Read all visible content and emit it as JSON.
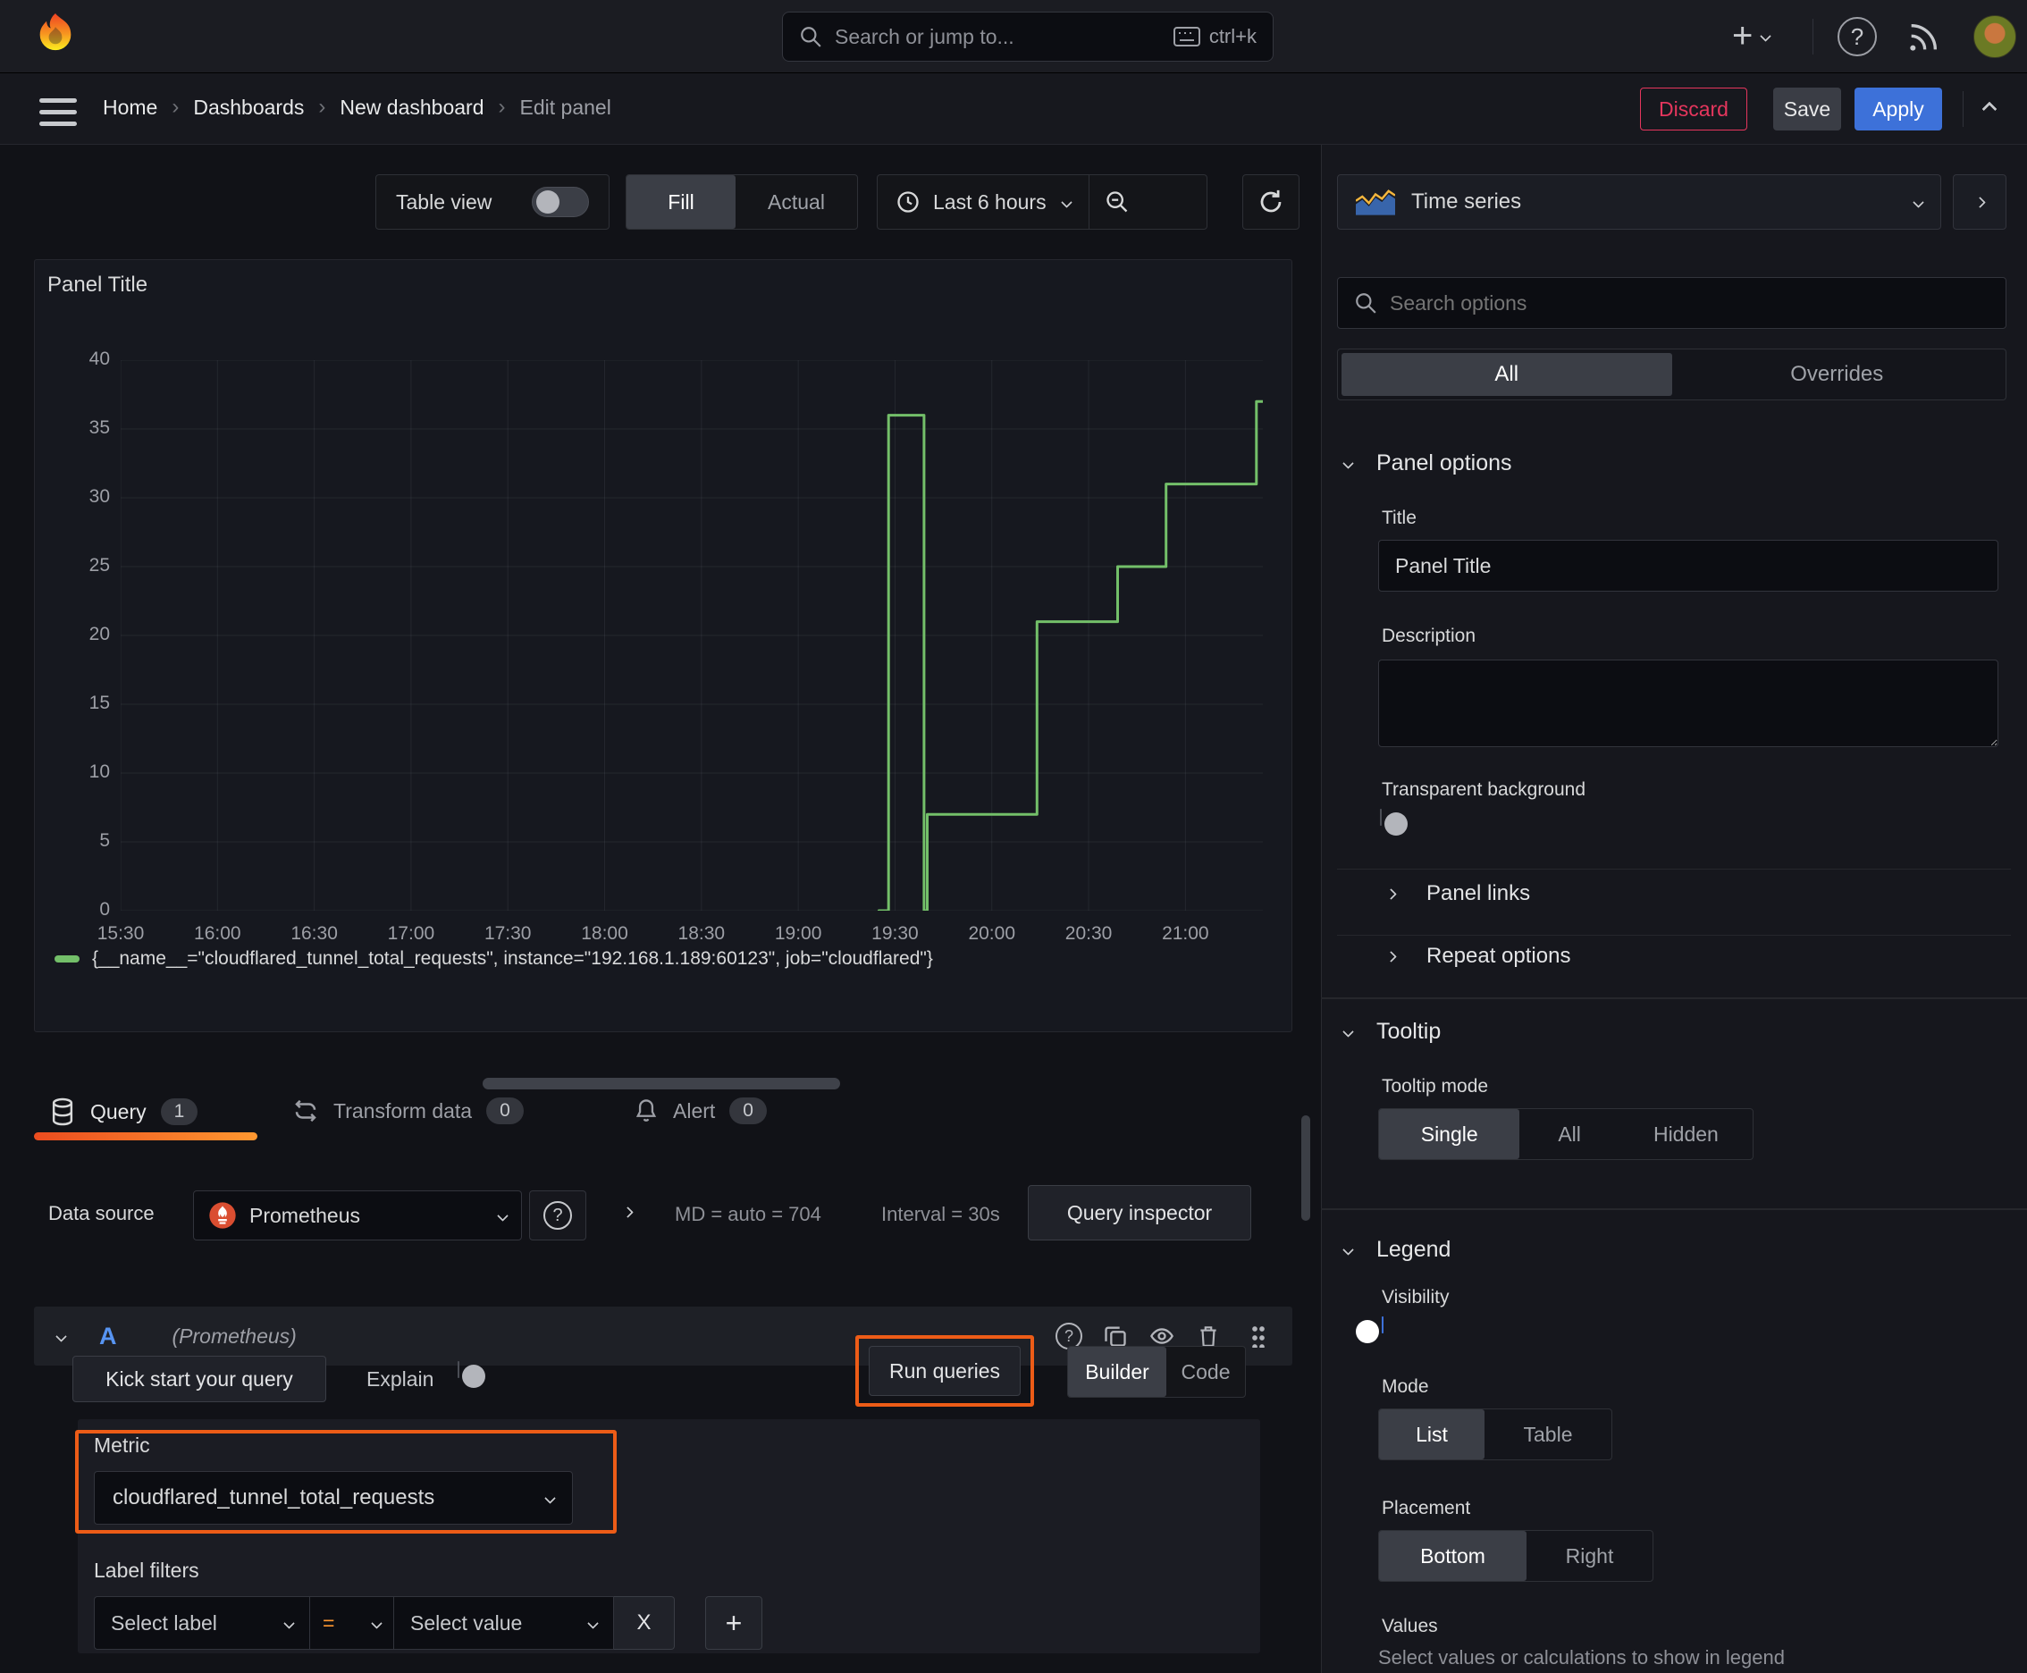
{
  "topbar": {
    "search_placeholder": "Search or jump to...",
    "search_shortcut": "ctrl+k"
  },
  "breadcrumb": {
    "items": [
      "Home",
      "Dashboards",
      "New dashboard"
    ],
    "current": "Edit panel",
    "separator": "›"
  },
  "actions": {
    "discard": "Discard",
    "save": "Save",
    "apply": "Apply"
  },
  "toolbar": {
    "table_view": "Table view",
    "fill": "Fill",
    "actual": "Actual",
    "time_range": "Last 6 hours"
  },
  "panel": {
    "title": "Panel Title"
  },
  "chart_data": {
    "type": "line",
    "style": "step-after",
    "title": "Panel Title",
    "xlabel": "",
    "ylabel": "",
    "ylim": [
      0,
      40
    ],
    "yticks": [
      0,
      5,
      10,
      15,
      20,
      25,
      30,
      35,
      40
    ],
    "xticks": [
      "15:30",
      "16:00",
      "16:30",
      "17:00",
      "17:30",
      "18:00",
      "18:30",
      "19:00",
      "19:30",
      "20:00",
      "20:30",
      "21:00"
    ],
    "x_max": "21:24",
    "grid": true,
    "legend_position": "bottom",
    "color": "#73bf69",
    "series": [
      {
        "name": "{__name__=\"cloudflared_tunnel_total_requests\", instance=\"192.168.1.189:60123\", job=\"cloudflared\"}",
        "points": [
          [
            "19:25",
            0
          ],
          [
            "19:28",
            0
          ],
          [
            "19:28",
            36
          ],
          [
            "19:39",
            36
          ],
          [
            "19:39",
            0
          ],
          [
            "19:40",
            0
          ],
          [
            "19:40",
            7
          ],
          [
            "20:14",
            7
          ],
          [
            "20:14",
            21
          ],
          [
            "20:39",
            21
          ],
          [
            "20:39",
            25
          ],
          [
            "20:54",
            25
          ],
          [
            "20:54",
            31
          ],
          [
            "21:22",
            31
          ],
          [
            "21:22",
            37
          ],
          [
            "21:24",
            37
          ]
        ]
      }
    ]
  },
  "tabs": {
    "query": "Query",
    "query_count": "1",
    "transform": "Transform data",
    "transform_count": "0",
    "alert": "Alert",
    "alert_count": "0"
  },
  "query": {
    "data_source_label": "Data source",
    "data_source": "Prometheus",
    "md": "MD = auto = 704",
    "interval": "Interval = 30s",
    "inspector": "Query inspector",
    "ref_id": "A",
    "ref_ds": "(Prometheus)",
    "kick_start": "Kick start your query",
    "explain": "Explain",
    "run": "Run queries",
    "builder": "Builder",
    "code": "Code",
    "metric_label": "Metric",
    "metric_value": "cloudflared_tunnel_total_requests",
    "label_filters": "Label filters",
    "select_label": "Select label",
    "operator": "=",
    "select_value": "Select value",
    "remove": "X",
    "add": "+"
  },
  "options": {
    "viz": "Time series",
    "search_placeholder": "Search options",
    "tab_all": "All",
    "tab_overrides": "Overrides",
    "panel_options": {
      "title": "Panel options",
      "title_label": "Title",
      "title_value": "Panel Title",
      "description_label": "Description",
      "transparent_label": "Transparent background"
    },
    "collapsed": [
      "Panel links",
      "Repeat options"
    ],
    "tooltip": {
      "title": "Tooltip",
      "mode_label": "Tooltip mode",
      "modes": [
        "Single",
        "All",
        "Hidden"
      ],
      "selected": "Single"
    },
    "legend": {
      "title": "Legend",
      "visibility_label": "Visibility",
      "mode_label": "Mode",
      "modes": [
        "List",
        "Table"
      ],
      "placement_label": "Placement",
      "placements": [
        "Bottom",
        "Right"
      ],
      "values_label": "Values",
      "values_hint": "Select values or calculations to show in legend"
    }
  },
  "colors": {
    "series_green": "#73bf69",
    "accent_orange_highlight": "#ed5c17",
    "tab_underline": "#ff6a13",
    "apply_blue": "#3d71d9",
    "discard_pink": "#e5365d",
    "toggle_on_blue": "#3d71d9"
  },
  "icons": [
    "grafana-logo",
    "search",
    "keyboard",
    "plus",
    "chevron-down",
    "help-circle",
    "rss",
    "avatar",
    "menu",
    "clock",
    "zoom-out",
    "refresh",
    "database",
    "transform-arrows",
    "bell",
    "copy",
    "eye",
    "trash",
    "grip",
    "flame-prometheus",
    "timeseries-viz",
    "magnifier",
    "close-x",
    "drag-handle"
  ]
}
